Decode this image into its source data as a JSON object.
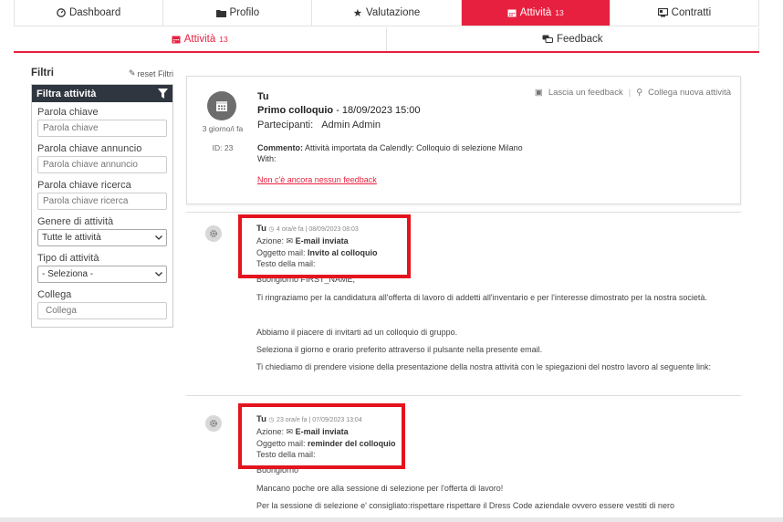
{
  "top_tabs": [
    {
      "label": "Dashboard",
      "icon": "dashboard-icon",
      "active": false
    },
    {
      "label": "Profilo",
      "icon": "folder-icon",
      "active": false
    },
    {
      "label": "Valutazione",
      "icon": "star-icon",
      "active": false
    },
    {
      "label": "Attività",
      "count": "13",
      "icon": "calendar-icon",
      "active": true
    },
    {
      "label": "Contratti",
      "icon": "contract-icon",
      "active": false
    }
  ],
  "sub_tabs": [
    {
      "label": "Attività",
      "count": "13",
      "active": true
    },
    {
      "label": "Feedback",
      "active": false
    }
  ],
  "filters": {
    "title": "Filtri",
    "reset_label": "reset Filtri",
    "panel_title": "Filtra attività",
    "keyword_label": "Parola chiave",
    "keyword_placeholder": "Parola chiave",
    "ad_keyword_label": "Parola chiave annuncio",
    "ad_keyword_placeholder": "Parola chiave annuncio",
    "search_keyword_label": "Parola chiave ricerca",
    "search_keyword_placeholder": "Parola chiave ricerca",
    "genre_label": "Genere di attività",
    "genre_value": "Tutte le attività",
    "type_label": "Tipo di attività",
    "type_value": "- Seleziona -",
    "link_label": "Collega",
    "link_placeholder": "Collega"
  },
  "activity_card": {
    "time_ago": "3 giorno/i fa",
    "id": "ID: 23",
    "feedback_action": "Lascia un feedback",
    "link_action": "Collega nuova attività",
    "author": "Tu",
    "title": "Primo colloquio",
    "date": "- 18/09/2023 15:00",
    "participants_label": "Partecipanti:",
    "participants_value": "Admin Admin",
    "comment_label": "Commento:",
    "comment_text": "Attività importata da Calendly: Colloquio di selezione Milano",
    "with_label": "With:",
    "no_feedback": "Non c'è ancora nessun feedback"
  },
  "emails": [
    {
      "author": "Tu",
      "meta": "4 ora/e fa | 08/09/2023 08:03",
      "action_label": "Azione:",
      "action_value": "E-mail inviata",
      "subject_label": "Oggetto mail:",
      "subject_value": "Invito al colloquio",
      "body_label": "Testo della mail:",
      "lines": [
        "Buongiorno FIRST_NAME,",
        "Ti ringraziamo per la candidatura all'offerta di lavoro di addetti all'inventario e per l'interesse dimostrato per la nostra società.",
        "Abbiamo il piacere di invitarti ad un colloquio di gruppo.",
        "Seleziona il giorno e orario preferito attraverso il pulsante nella presente email.",
        "Ti chiediamo di prendere visione della presentazione della nostra attività con le spiegazioni del nostro lavoro al seguente link:"
      ]
    },
    {
      "author": "Tu",
      "meta": "23 ora/e fa | 07/09/2023 13:04",
      "action_label": "Azione:",
      "action_value": "E-mail inviata",
      "subject_label": "Oggetto mail:",
      "subject_value": "reminder del colloquio",
      "body_label": "Testo della mail:",
      "lines": [
        "Buongiorno",
        "Mancano poche ore alla sessione di selezione per l'offerta di lavoro!",
        "Per la sessione di selezione e' consigliato:rispettare rispettare il Dress Code aziendale ovvero essere vestiti di nero"
      ]
    }
  ],
  "colors": {
    "accent": "#e8203f",
    "highlight_box": "#e3141e",
    "filter_bar": "#2f3640"
  }
}
